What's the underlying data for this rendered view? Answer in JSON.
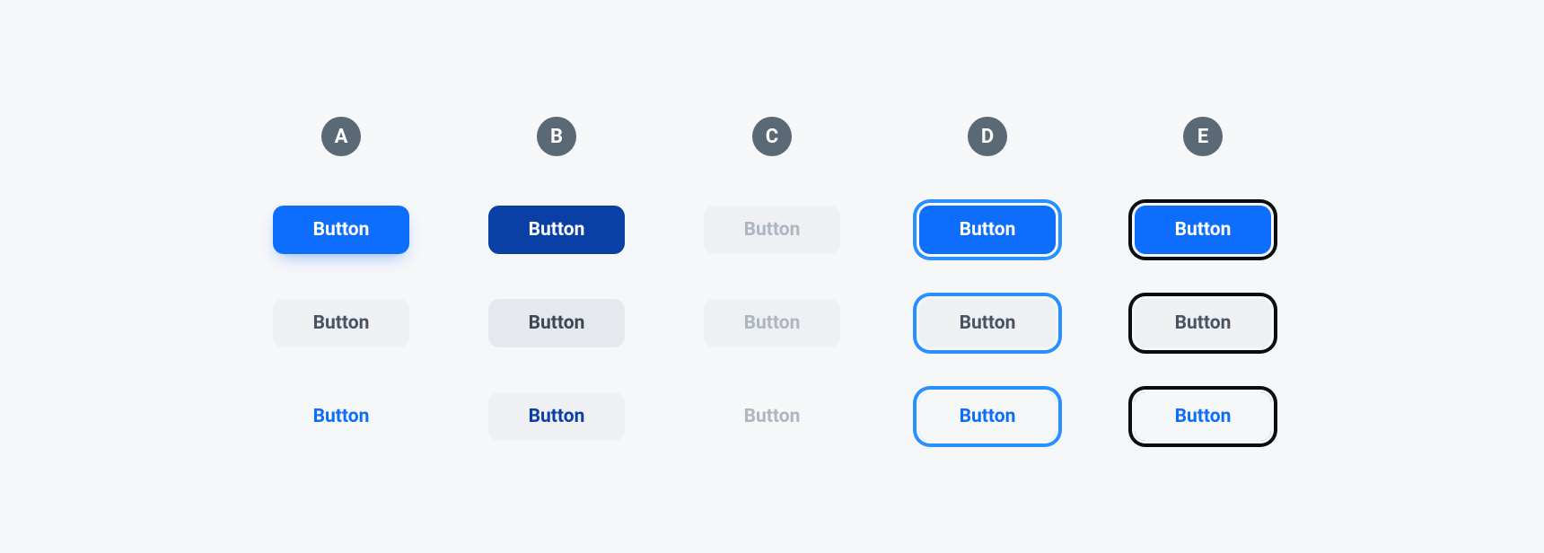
{
  "columns": [
    {
      "id": "A",
      "label": "A"
    },
    {
      "id": "B",
      "label": "B"
    },
    {
      "id": "C",
      "label": "C"
    },
    {
      "id": "D",
      "label": "D"
    },
    {
      "id": "E",
      "label": "E"
    }
  ],
  "rows": {
    "primary": {
      "label": "Button"
    },
    "secondary": {
      "label": "Button"
    },
    "tertiary": {
      "label": "Button"
    }
  },
  "colors": {
    "brand": "#0d6efd",
    "brand_active": "#0a3fa6",
    "focus_ring_brand": "#2a90ff",
    "focus_ring_black": "#0b0d10",
    "neutral_bg": "#eef0f3",
    "text_muted": "#4a5361",
    "text_disabled": "#aeb6c1",
    "page_bg": "#f6f7f9"
  }
}
